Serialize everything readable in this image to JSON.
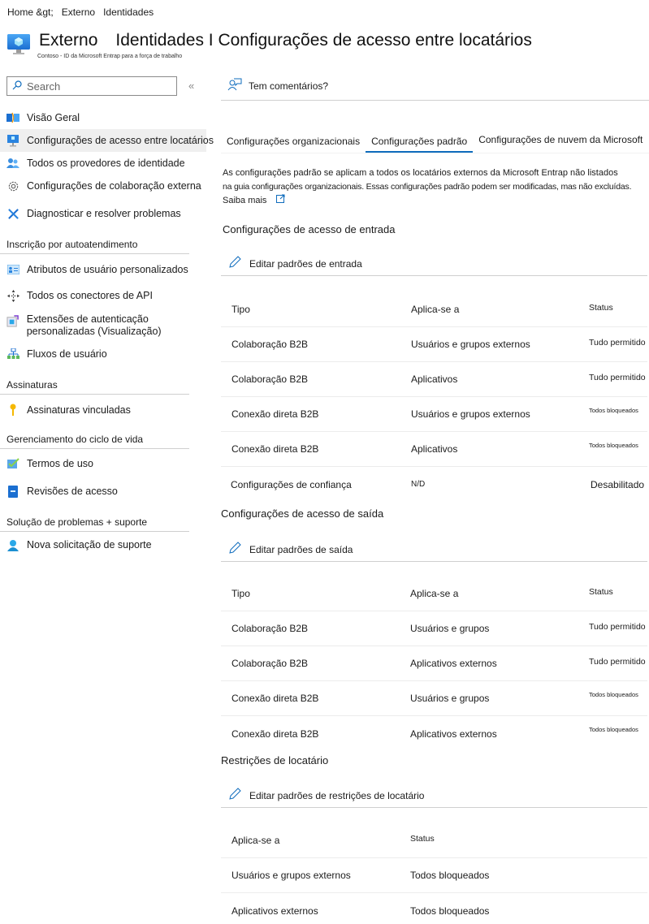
{
  "breadcrumb": [
    "Home &gt;",
    "Externo",
    "Identidades"
  ],
  "header": {
    "title_part1": "Externo",
    "title_part2": "Identidades I Configurações de acesso entre locatários",
    "subtitle": "Contoso - ID da Microsoft Entrap para a força de trabalho"
  },
  "search": {
    "placeholder": "Search",
    "collapse_icon": "«"
  },
  "sidebar": {
    "items_top": [
      {
        "label": "Visão Geral",
        "icon": "overview-icon"
      },
      {
        "label": "Configurações de acesso entre locatários",
        "icon": "cross-tenant-icon",
        "active": true
      },
      {
        "label": "Todos os provedores de identidade",
        "icon": "identity-providers-icon"
      },
      {
        "label": "Configurações de colaboração externa",
        "icon": "gear-icon"
      },
      {
        "label": "Diagnosticar e resolver problemas",
        "icon": "wrench-icon"
      }
    ],
    "sections": [
      {
        "title": "Inscrição por autoatendimento",
        "items": [
          {
            "label": "Atributos de usuário personalizados",
            "icon": "user-attributes-icon"
          },
          {
            "label": "Todos os conectores de API",
            "icon": "api-connectors-icon"
          },
          {
            "label": "Extensões de autenticação personalizadas (Visualização)",
            "icon": "auth-extensions-icon"
          },
          {
            "label": "Fluxos de usuário",
            "icon": "user-flows-icon"
          }
        ]
      },
      {
        "title": "Assinaturas",
        "items": [
          {
            "label": "Assinaturas vinculadas",
            "icon": "key-icon"
          }
        ]
      },
      {
        "title": "Gerenciamento do ciclo de vida",
        "items": [
          {
            "label": "Termos de uso",
            "icon": "terms-checkmark-icon"
          },
          {
            "label": "Revisões de acesso",
            "icon": "access-reviews-icon"
          }
        ]
      },
      {
        "title": "Solução de problemas + suporte",
        "items": [
          {
            "label": "Nova solicitação de suporte",
            "icon": "support-person-icon"
          }
        ]
      }
    ]
  },
  "main": {
    "feedback_label": "Tem comentários?",
    "tabs": [
      {
        "label": "Configurações organizacionais",
        "active": false
      },
      {
        "label": "Configurações padrão",
        "active": true
      },
      {
        "label": "Configurações de nuvem da Microsoft",
        "active": false
      }
    ],
    "description_line1": "As configurações padrão se aplicam a todos os locatários externos da Microsoft Entrap não listados",
    "description_line2": "na guia configurações organizacionais. Essas configurações padrão podem ser modificadas, mas não excluídas.",
    "learn_more": "Saiba mais",
    "inbound": {
      "title": "Configurações de acesso de entrada",
      "edit_label": "Editar padrões de entrada",
      "headers": [
        "Tipo",
        "Aplica-se a",
        "Status"
      ],
      "rows": [
        {
          "tipo": "Colaboração B2B",
          "aplica": "Usuários e grupos externos",
          "status": "Tudo permitido"
        },
        {
          "tipo": "Colaboração B2B",
          "aplica": "Aplicativos",
          "status": "Tudo permitido"
        },
        {
          "tipo": "Conexão direta B2B",
          "aplica": "Usuários e grupos externos",
          "status": "Todos bloqueados"
        },
        {
          "tipo": "Conexão direta B2B",
          "aplica": "Aplicativos",
          "status": "Todos bloqueados"
        },
        {
          "tipo": "Configurações de confiança",
          "aplica": "N/D",
          "status": "Desabilitado"
        }
      ]
    },
    "outbound": {
      "title": "Configurações de acesso de saída",
      "edit_label": "Editar padrões de saída",
      "headers": [
        "Tipo",
        "Aplica-se a",
        "Status"
      ],
      "rows": [
        {
          "tipo": "Colaboração B2B",
          "aplica": "Usuários e grupos",
          "status": "Tudo permitido"
        },
        {
          "tipo": "Colaboração B2B",
          "aplica": "Aplicativos externos",
          "status": "Tudo permitido"
        },
        {
          "tipo": "Conexão direta B2B",
          "aplica": "Usuários e grupos",
          "status": "Todos bloqueados"
        },
        {
          "tipo": "Conexão direta B2B",
          "aplica": "Aplicativos externos",
          "status": "Todos bloqueados"
        }
      ]
    },
    "tenant_restrictions": {
      "title": "Restrições de locatário",
      "edit_label": "Editar padrões de restrições de locatário",
      "headers": [
        "Aplica-se a",
        "Status"
      ],
      "rows": [
        {
          "aplica": "Usuários e grupos externos",
          "status": "Todos bloqueados"
        },
        {
          "aplica": "Aplicativos externos",
          "status": "Todos bloqueados"
        }
      ]
    }
  },
  "colors": {
    "accent": "#0f6cbd",
    "active_nav_bg": "#efefef",
    "divider": "#cfcfcf"
  }
}
